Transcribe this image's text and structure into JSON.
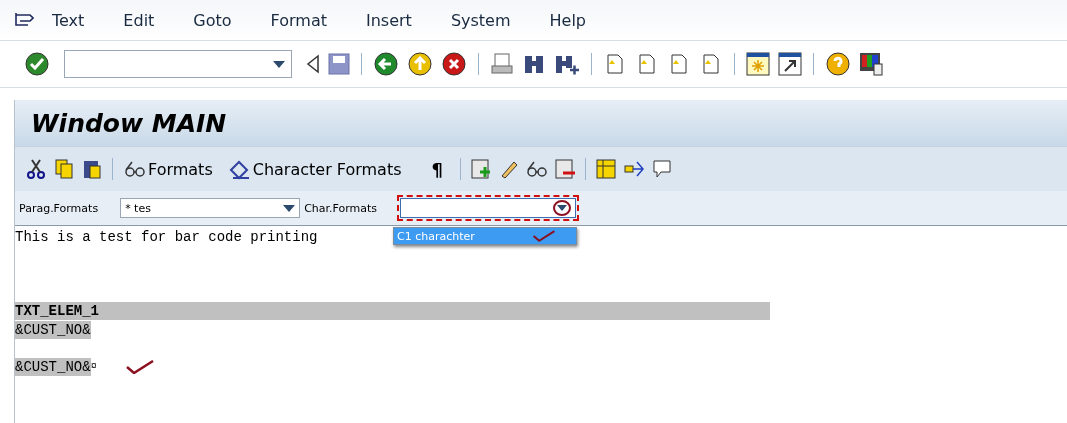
{
  "menu": [
    "Text",
    "Edit",
    "Goto",
    "Format",
    "Insert",
    "System",
    "Help"
  ],
  "window_title": "Window MAIN",
  "format_toolbar": [
    {
      "kind": "icon"
    },
    {
      "kind": "icon"
    },
    {
      "kind": "icon"
    },
    {
      "kind": "sep"
    },
    {
      "kind": "text",
      "label": "Formats"
    },
    {
      "kind": "text",
      "label": "Character Formats"
    },
    {
      "kind": "glyph",
      "label": "¶"
    },
    {
      "kind": "sep"
    },
    {
      "kind": "icon"
    },
    {
      "kind": "icon"
    },
    {
      "kind": "icon"
    },
    {
      "kind": "icon"
    },
    {
      "kind": "sep"
    },
    {
      "kind": "icon"
    },
    {
      "kind": "icon"
    },
    {
      "kind": "icon"
    }
  ],
  "paragraph_formats": {
    "label": "Parag.Formats",
    "value": "* tes"
  },
  "character_formats": {
    "label": "Char.Formats",
    "expanded": true,
    "options": [
      {
        "label": "C1 charachter",
        "selected": true
      }
    ]
  },
  "editor_lines": [
    {
      "kind": "plain",
      "text": "This is a test for bar code printing"
    },
    {
      "kind": "blank"
    },
    {
      "kind": "blank"
    },
    {
      "kind": "blank"
    },
    {
      "kind": "element",
      "text": "TXT_ELEM_1"
    },
    {
      "kind": "field",
      "text": "&CUST_NO&"
    },
    {
      "kind": "blank"
    },
    {
      "kind": "field",
      "text": "&CUST_NO&",
      "suffix": "¤",
      "checkmark": true
    }
  ]
}
